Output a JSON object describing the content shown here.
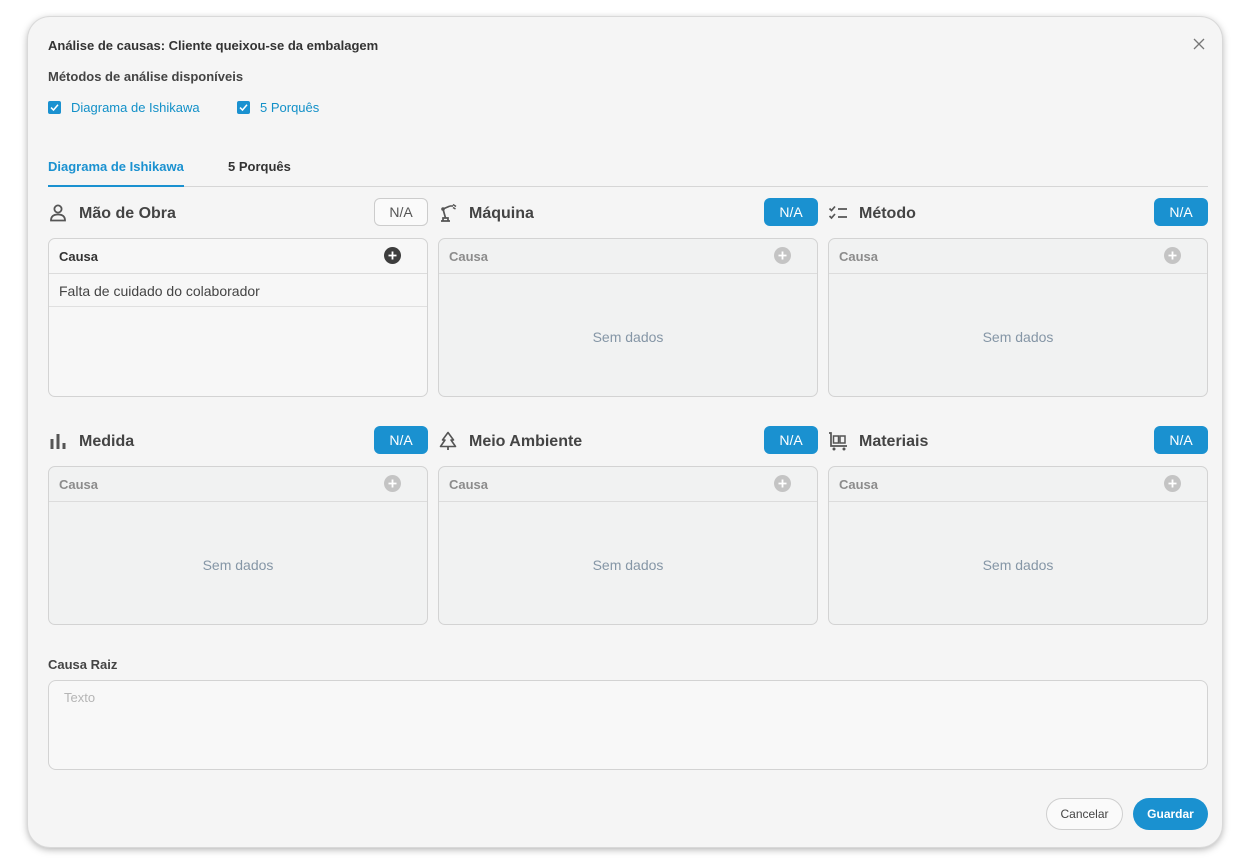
{
  "dialog": {
    "title": "Análise de causas: Cliente queixou-se da embalagem",
    "methods_label": "Métodos de análise disponíveis",
    "methods": [
      {
        "label": "Diagrama de Ishikawa",
        "checked": true
      },
      {
        "label": "5 Porquês",
        "checked": true
      }
    ]
  },
  "tabs": [
    {
      "label": "Diagrama de Ishikawa",
      "active": true
    },
    {
      "label": "5 Porquês",
      "active": false
    }
  ],
  "categories": [
    {
      "title": "Mão de Obra",
      "icon": "person-icon",
      "na_label": "N/A",
      "na_active": false,
      "column_header": "Causa",
      "rows": [
        "Falta de cuidado do colaborador"
      ],
      "empty_text": ""
    },
    {
      "title": "Máquina",
      "icon": "robot-arm-icon",
      "na_label": "N/A",
      "na_active": true,
      "column_header": "Causa",
      "rows": [],
      "empty_text": "Sem dados"
    },
    {
      "title": "Método",
      "icon": "checklist-icon",
      "na_label": "N/A",
      "na_active": true,
      "column_header": "Causa",
      "rows": [],
      "empty_text": "Sem dados"
    },
    {
      "title": "Medida",
      "icon": "bar-chart-icon",
      "na_label": "N/A",
      "na_active": true,
      "column_header": "Causa",
      "rows": [],
      "empty_text": "Sem dados"
    },
    {
      "title": "Meio Ambiente",
      "icon": "tree-icon",
      "na_label": "N/A",
      "na_active": true,
      "column_header": "Causa",
      "rows": [],
      "empty_text": "Sem dados"
    },
    {
      "title": "Materiais",
      "icon": "trolley-icon",
      "na_label": "N/A",
      "na_active": true,
      "column_header": "Causa",
      "rows": [],
      "empty_text": "Sem dados"
    }
  ],
  "root_cause": {
    "label": "Causa Raiz",
    "placeholder": "Texto",
    "value": ""
  },
  "footer": {
    "cancel_label": "Cancelar",
    "save_label": "Guardar"
  },
  "colors": {
    "accent": "#1a91d0",
    "background": "#f5f5f5"
  }
}
